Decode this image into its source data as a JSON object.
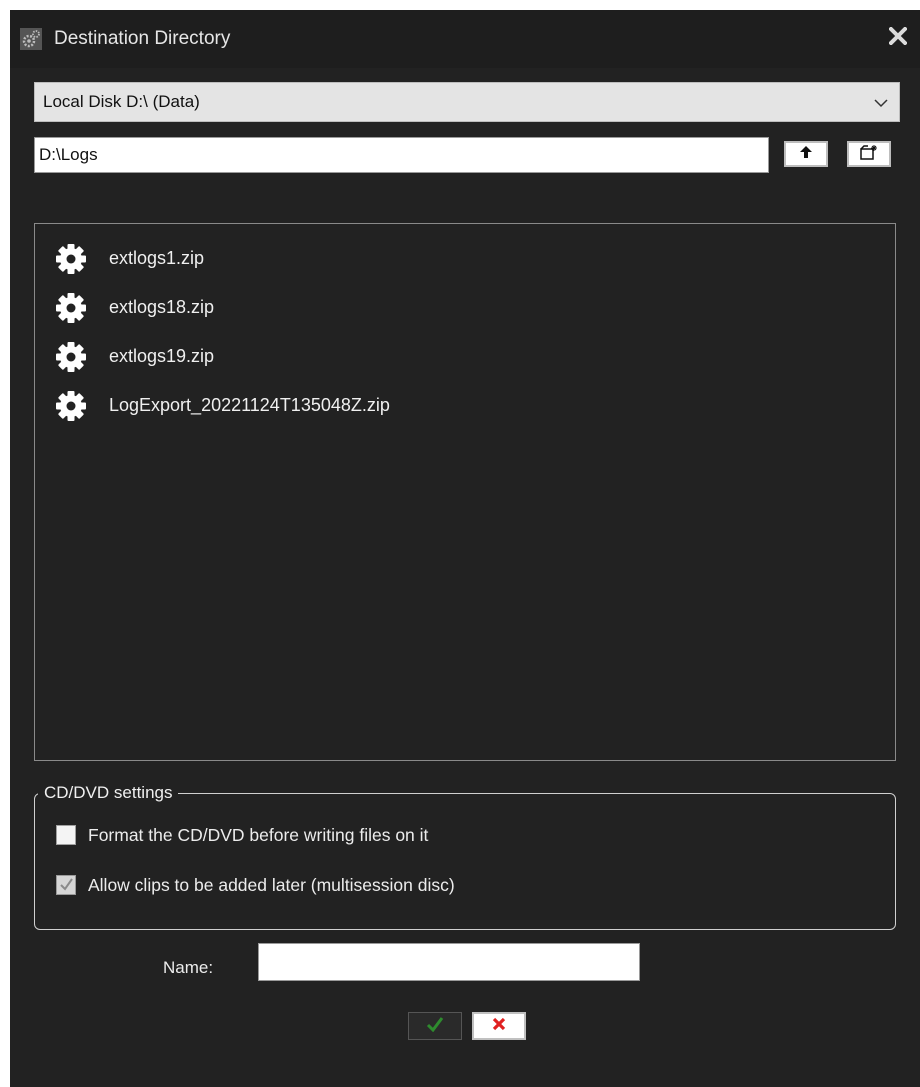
{
  "window": {
    "title": "Destination Directory",
    "title_icon": "gears-icon",
    "close_icon": "close-icon"
  },
  "drive_select": {
    "value": "Local Disk D:\\ (Data)",
    "icon": "chevron-down-icon"
  },
  "path": {
    "value": "D:\\Logs"
  },
  "toolbar": {
    "up_icon": "arrow-up-icon",
    "new_folder_icon": "new-folder-icon"
  },
  "files": [
    {
      "name": "extlogs1.zip",
      "icon": "gear-icon"
    },
    {
      "name": "extlogs18.zip",
      "icon": "gear-icon"
    },
    {
      "name": "extlogs19.zip",
      "icon": "gear-icon"
    },
    {
      "name": "LogExport_20221124T135048Z.zip",
      "icon": "gear-icon"
    }
  ],
  "cd_dvd": {
    "legend": "CD/DVD settings",
    "options": [
      {
        "label": "Format the CD/DVD before writing files on it",
        "checked": false,
        "enabled": true
      },
      {
        "label": "Allow clips to be added later (multisession disc)",
        "checked": true,
        "enabled": false
      }
    ]
  },
  "name_field": {
    "label": "Name:",
    "value": ""
  },
  "buttons": {
    "ok_icon": "checkmark-icon",
    "cancel_icon": "x-icon"
  },
  "colors": {
    "background": "#222222",
    "ok_green": "#2e8b2e",
    "cancel_red": "#e02020"
  }
}
